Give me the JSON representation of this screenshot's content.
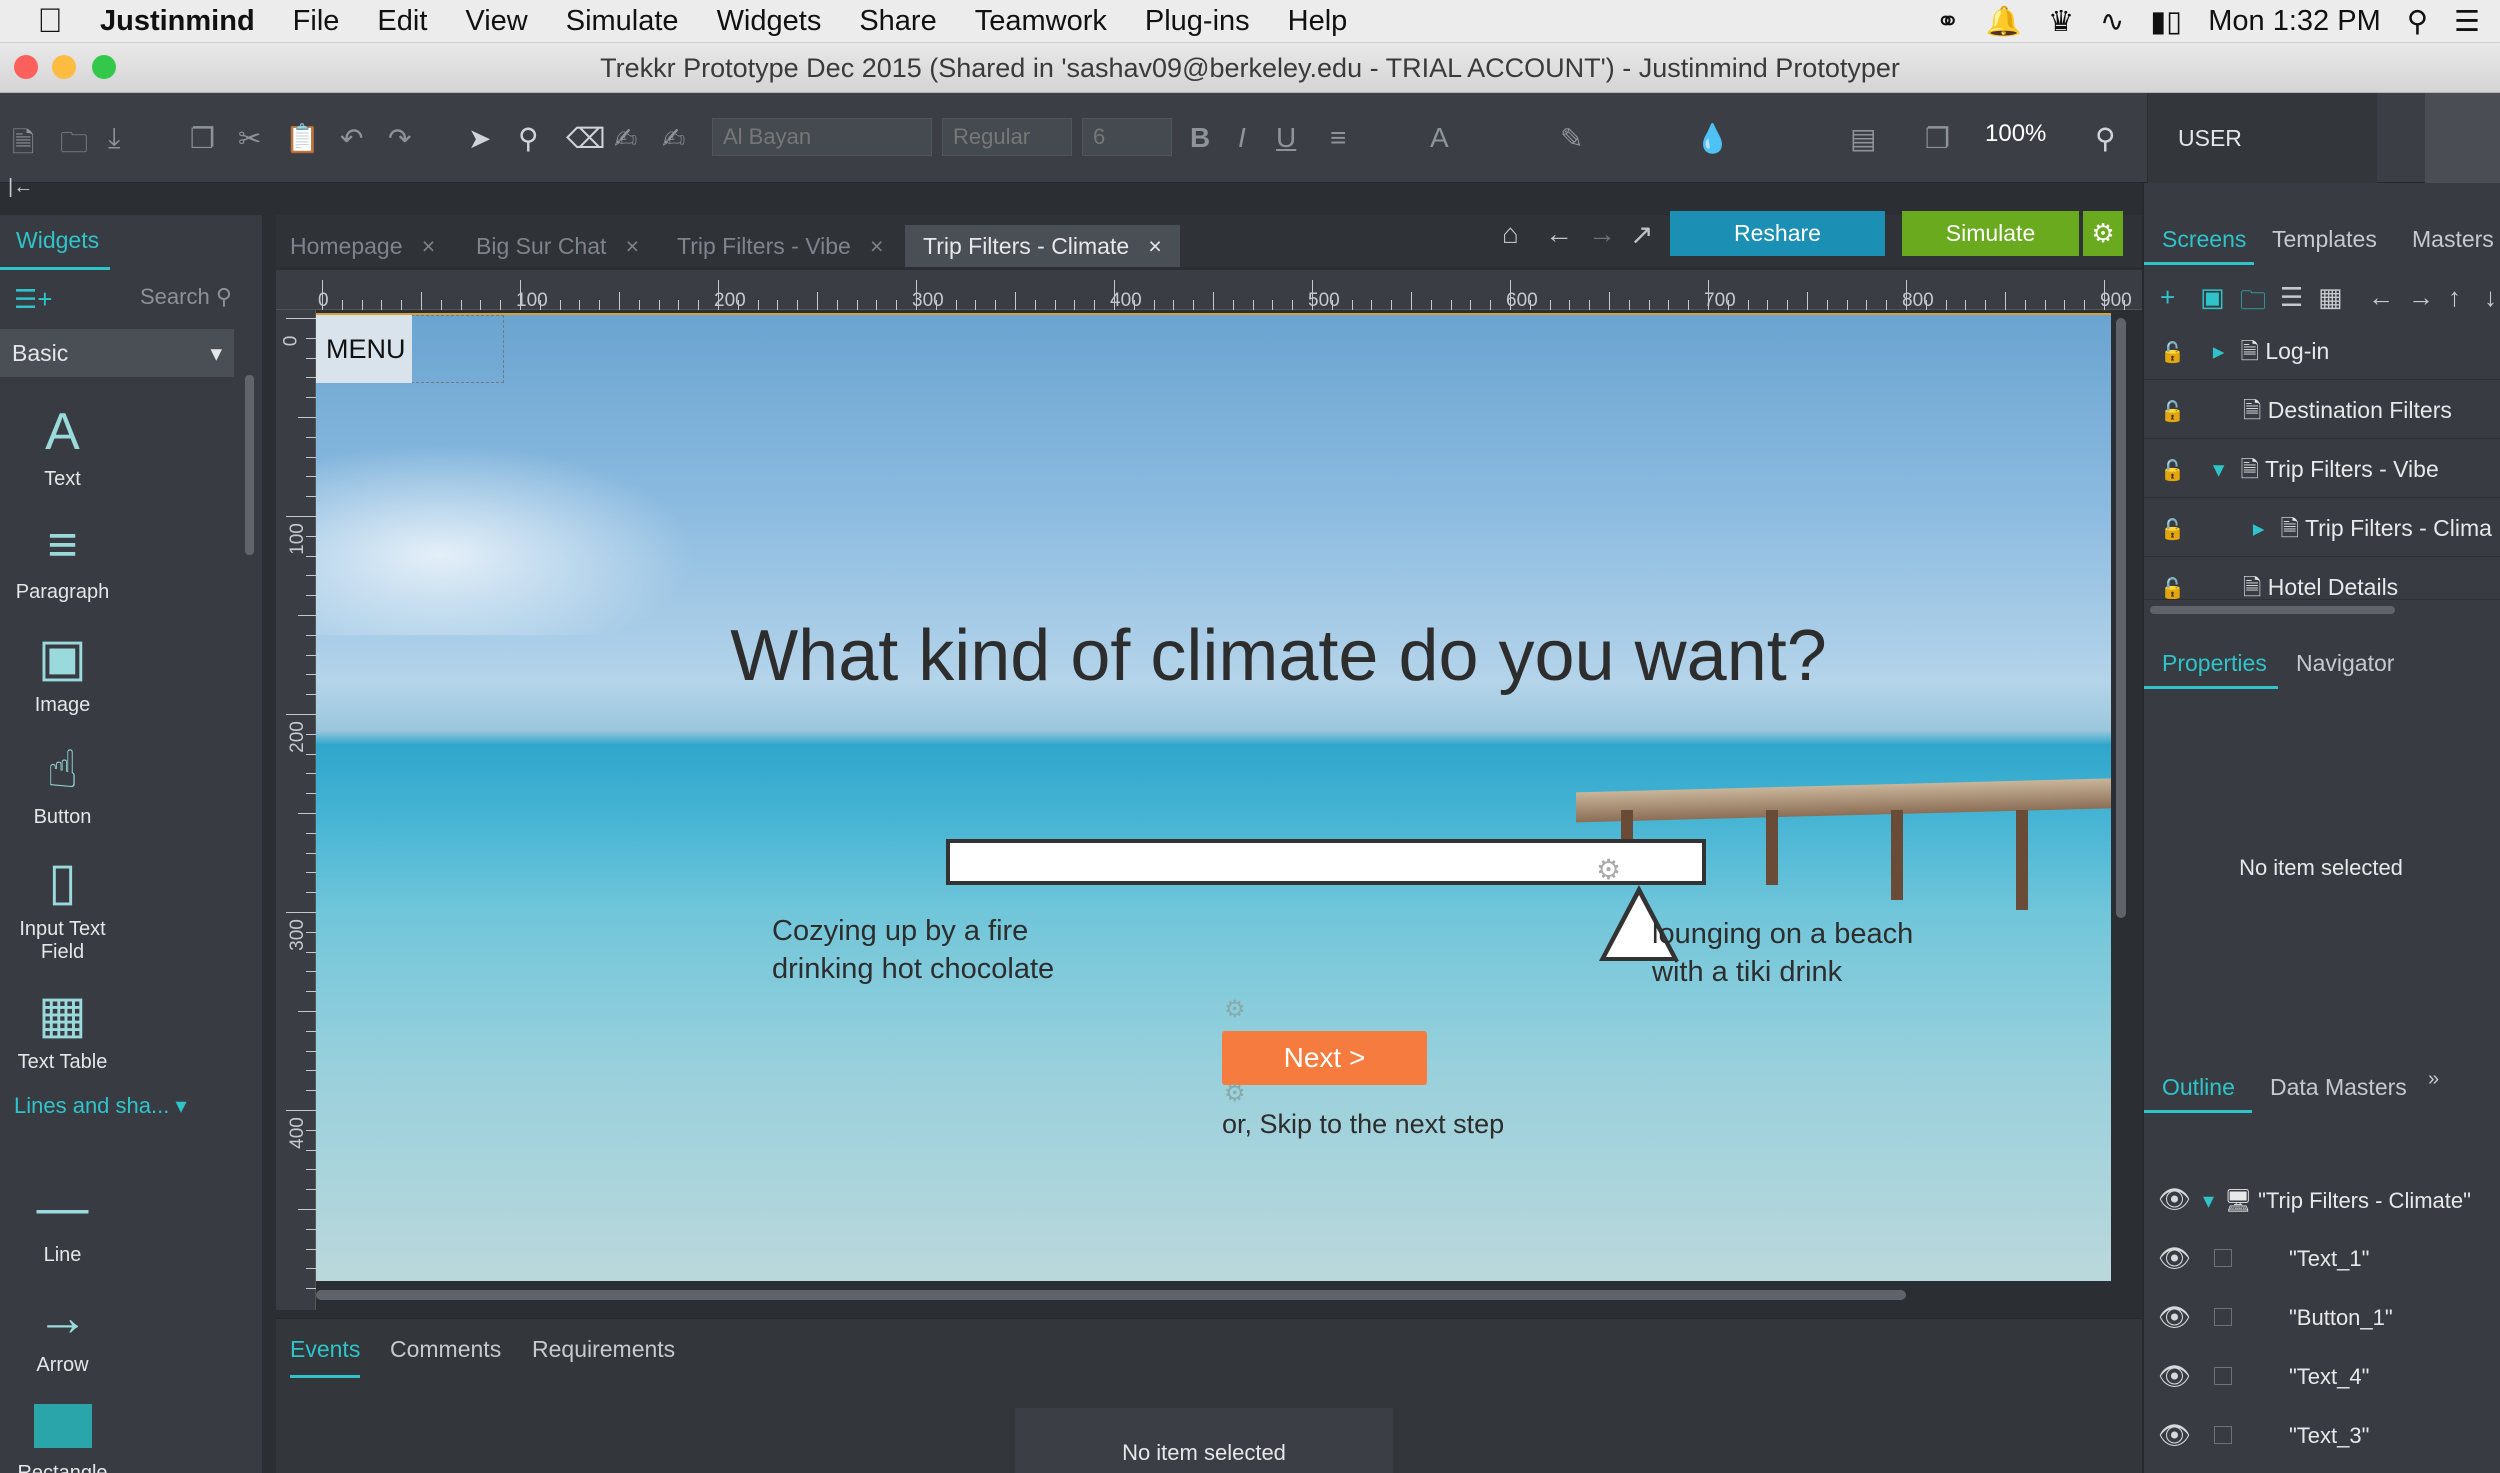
{
  "menubar": {
    "app": "Justinmind",
    "items": [
      "File",
      "Edit",
      "View",
      "Simulate",
      "Widgets",
      "Share",
      "Teamwork",
      "Plug-ins",
      "Help"
    ],
    "clock": "Mon 1:32 PM"
  },
  "window": {
    "title": "Trekkr Prototype Dec 2015 (Shared in 'sashav09@berkeley.edu - TRIAL ACCOUNT') - Justinmind Prototyper"
  },
  "toolbar": {
    "font": "Al Bayan",
    "weight": "Regular",
    "size": "6",
    "zoom": "100%",
    "mode": "USER INTERFACE"
  },
  "left_panel": {
    "tab": "Widgets",
    "search_placeholder": "Search",
    "category": "Basic",
    "widgets": [
      "Text",
      "Paragraph",
      "Image",
      "Button",
      "Input Text Field",
      "Text Table"
    ],
    "category2": "Lines and sha...",
    "widgets2": [
      "Line",
      "Arrow",
      "Rectangle"
    ]
  },
  "tabs": [
    "Homepage",
    "Big Sur Chat",
    "Trip Filters - Vibe",
    "Trip Filters - Climate"
  ],
  "actions": {
    "reshare": "Reshare",
    "simulate": "Simulate"
  },
  "ruler_h": [
    "0",
    "100",
    "200",
    "300",
    "400",
    "500",
    "600",
    "700",
    "800",
    "900"
  ],
  "ruler_v": [
    "0",
    "100",
    "200",
    "300",
    "400"
  ],
  "canvas": {
    "menu": "MENU",
    "headline": "What kind of climate do you want?",
    "left_label_1": "Cozying up by a fire",
    "left_label_2": "drinking hot chocolate",
    "right_label_1": "lounging on a beach",
    "right_label_2": "with a tiki drink",
    "next": "Next >",
    "skip": "or, Skip to the next step"
  },
  "bottom_panel": {
    "tabs": [
      "Events",
      "Comments",
      "Requirements"
    ],
    "empty": "No item selected"
  },
  "right_panel": {
    "tabs": [
      "Screens",
      "Templates",
      "Masters"
    ],
    "screens": [
      "Log-in",
      "Destination Filters",
      "Trip Filters - Vibe",
      "Trip Filters - Clima",
      "Hotel Details"
    ],
    "prop_tabs": [
      "Properties",
      "Navigator"
    ],
    "prop_empty": "No item selected",
    "outline_tabs": [
      "Outline",
      "Data Masters"
    ],
    "outline": [
      "\"Trip Filters - Climate\"",
      "\"Text_1\"",
      "\"Button_1\"",
      "\"Text_4\"",
      "\"Text_3\""
    ]
  },
  "colors": {
    "accent": "#2ec4c9",
    "reshare": "#1c8fb5",
    "simulate": "#6aaa1e",
    "next": "#f57c3e"
  }
}
